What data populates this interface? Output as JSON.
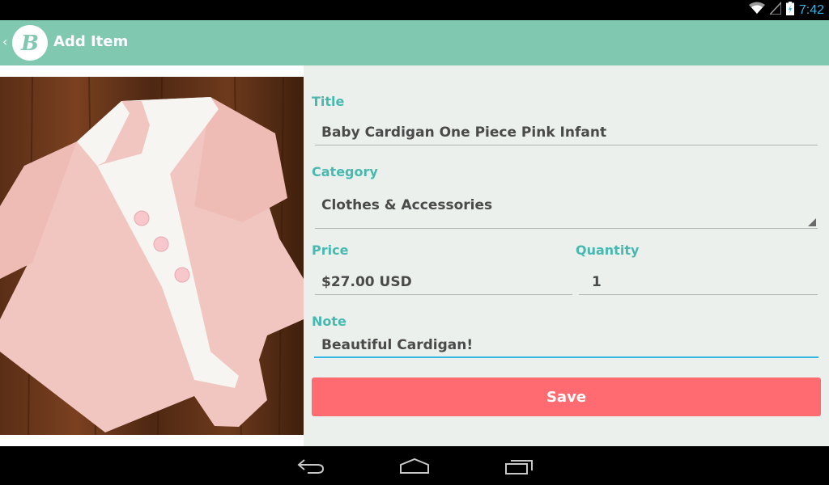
{
  "status_bar": {
    "time": "7:42"
  },
  "action_bar": {
    "title": "Add Item"
  },
  "form": {
    "title_label": "Title",
    "title_value": "Baby Cardigan One Piece Pink Infant",
    "category_label": "Category",
    "category_value": "Clothes & Accessories",
    "price_label": "Price",
    "price_value": "$27.00 USD",
    "quantity_label": "Quantity",
    "quantity_value": "1",
    "note_label": "Note",
    "note_value": "Beautiful Cardigan!",
    "save_label": "Save"
  },
  "colors": {
    "action_bar": "#80c8b0",
    "label_teal": "#47b9b0",
    "save_button": "#ff6b70",
    "status_accent": "#33b5e5"
  },
  "icons": [
    "wifi-icon",
    "signal-icon",
    "battery-icon",
    "back-chevron-icon",
    "app-logo-icon",
    "dropdown-arrow-icon",
    "nav-back-icon",
    "nav-home-icon",
    "nav-recents-icon"
  ]
}
